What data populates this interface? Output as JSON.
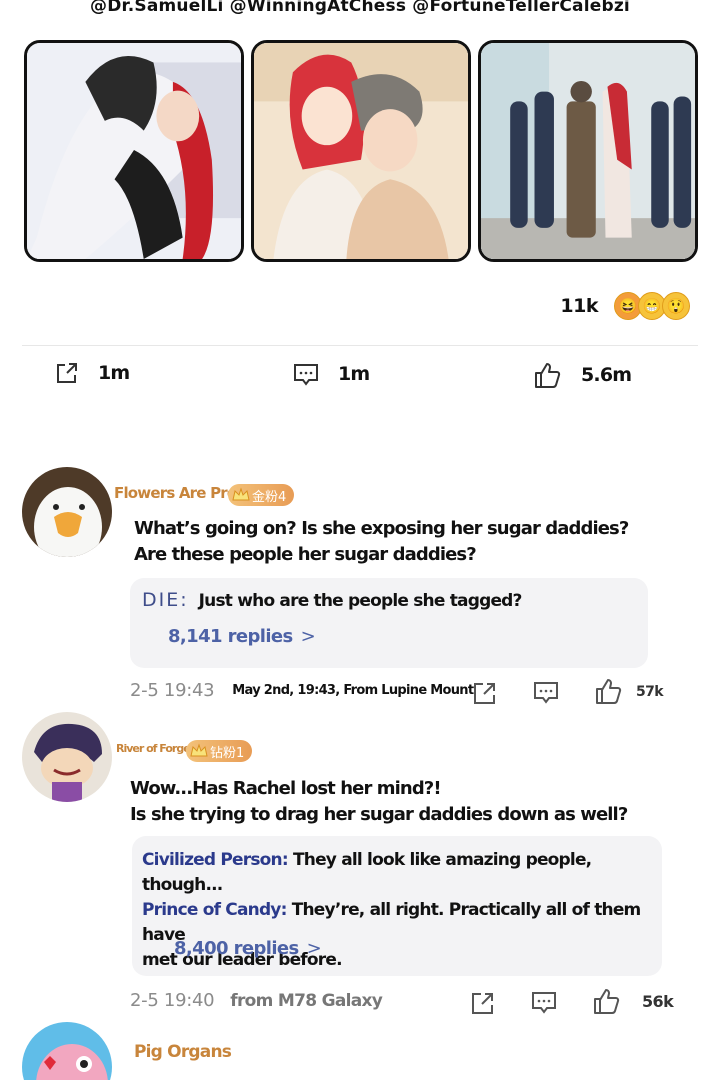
{
  "header": {
    "tags": "@Dr.SamuelLi @WinningAtChess @FortuneTellerCalebzi"
  },
  "reactions": {
    "count": "11k",
    "emojis": [
      "laughing-face-icon",
      "grinning-face-icon",
      "shocked-face-icon"
    ]
  },
  "stats": {
    "share": "1m",
    "comments": "1m",
    "likes": "5.6m"
  },
  "comments": [
    {
      "username": "Flowers Are Pretty",
      "badge": "金粉4",
      "text_lines": [
        "What’s going on? Is she exposing her sugar daddies?",
        "Are these people her sugar daddies?"
      ],
      "replies": [
        {
          "name": "DIE:",
          "text": "Just who are the people she tagged?"
        }
      ],
      "reply_count": "8,141 replies",
      "date": "2-5 19:43",
      "location": "May 2nd, 19:43, From Lupine Mount",
      "likes": "57k"
    },
    {
      "username": "River of Forgetfulness",
      "badge": "钻粉1",
      "text_lines": [
        "Wow...Has Rachel lost her mind?!",
        "Is she trying to drag her sugar daddies down as well?"
      ],
      "replies": [
        {
          "name": "Civilized Person:",
          "text": " They all look like amazing people, though..."
        },
        {
          "name": "Prince of Candy:",
          "text": " They’re, all right. Practically all of them have"
        },
        {
          "name": "",
          "text": "met our leader before."
        }
      ],
      "reply_count": "8,400 replies",
      "date": "2-5 19:40",
      "location": "from M78 Galaxy",
      "likes": "56k"
    },
    {
      "username": "Pig Organs"
    }
  ],
  "colors": {
    "username": "#c8853b",
    "reply_link": "#4d62a6",
    "reply_name": "#2b3a8c",
    "reply_bg": "#f3f3f5"
  }
}
